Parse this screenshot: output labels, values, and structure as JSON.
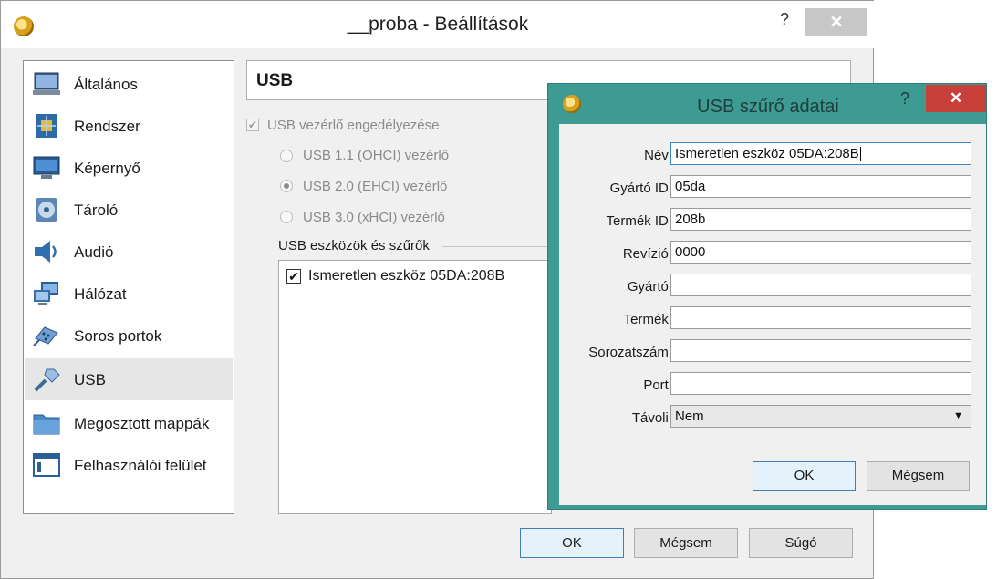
{
  "main": {
    "title": "__proba - Beállítások",
    "help": "?",
    "close": "✕",
    "sidebar": [
      {
        "label": "Általános",
        "icon": "monitor-icon"
      },
      {
        "label": "Rendszer",
        "icon": "chip-icon"
      },
      {
        "label": "Képernyő",
        "icon": "display-icon"
      },
      {
        "label": "Tároló",
        "icon": "disk-icon"
      },
      {
        "label": "Audió",
        "icon": "speaker-icon"
      },
      {
        "label": "Hálózat",
        "icon": "network-icon"
      },
      {
        "label": "Soros portok",
        "icon": "serial-port-icon"
      },
      {
        "label": "USB",
        "icon": "usb-plug-icon",
        "selected": true
      },
      {
        "label": "Megosztott mappák",
        "icon": "folder-icon"
      },
      {
        "label": "Felhasználói felület",
        "icon": "window-icon"
      }
    ],
    "page_title": "USB",
    "enable_usb": {
      "label": "USB vezérlő engedélyezése",
      "checked": true
    },
    "controllers": [
      {
        "label": "USB 1.1 (OHCI) vezérlő",
        "selected": false
      },
      {
        "label": "USB 2.0 (EHCI) vezérlő",
        "selected": true
      },
      {
        "label": "USB 3.0 (xHCI) vezérlő",
        "selected": false
      }
    ],
    "filters_label": "USB eszközök és szűrők",
    "filters": [
      {
        "label": "Ismeretlen eszköz 05DA:208B",
        "checked": true
      }
    ],
    "buttons": {
      "ok": "OK",
      "cancel": "Mégsem",
      "help": "Súgó"
    }
  },
  "dialog": {
    "title": "USB szűrő adatai",
    "help": "?",
    "close": "✕",
    "fields": [
      {
        "label": "Név:",
        "value": "Ismeretlen eszköz 05DA:208B"
      },
      {
        "label": "Gyártó ID:",
        "value": "05da"
      },
      {
        "label": "Termék ID:",
        "value": "208b"
      },
      {
        "label": "Revízió:",
        "value": "0000"
      },
      {
        "label": "Gyártó:",
        "value": ""
      },
      {
        "label": "Termék:",
        "value": ""
      },
      {
        "label": "Sorozatszám:",
        "value": ""
      },
      {
        "label": "Port:",
        "value": ""
      }
    ],
    "remote": {
      "label": "Távoli:",
      "value": "Nem"
    },
    "buttons": {
      "ok": "OK",
      "cancel": "Mégsem"
    }
  }
}
